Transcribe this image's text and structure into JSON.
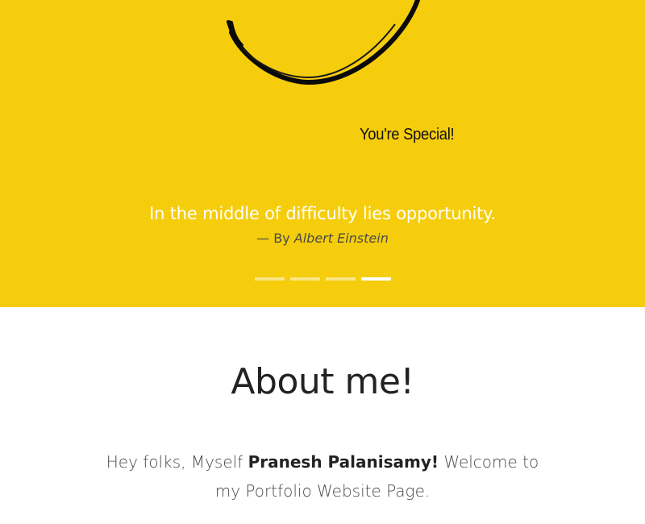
{
  "carousel": {
    "image_text": "You're Special!",
    "quote": "In the middle of difficulty lies opportunity.",
    "author_prefix": "— By ",
    "author_name": "Albert Einstein",
    "slide_count": 4,
    "active_slide": 4,
    "background_color": "#f5cd0c"
  },
  "about": {
    "title": "About me!",
    "intro_before": "Hey folks, Myself ",
    "name": "Pranesh Palanisamy!",
    "intro_after": " Welcome to my Portfolio Website Page."
  }
}
